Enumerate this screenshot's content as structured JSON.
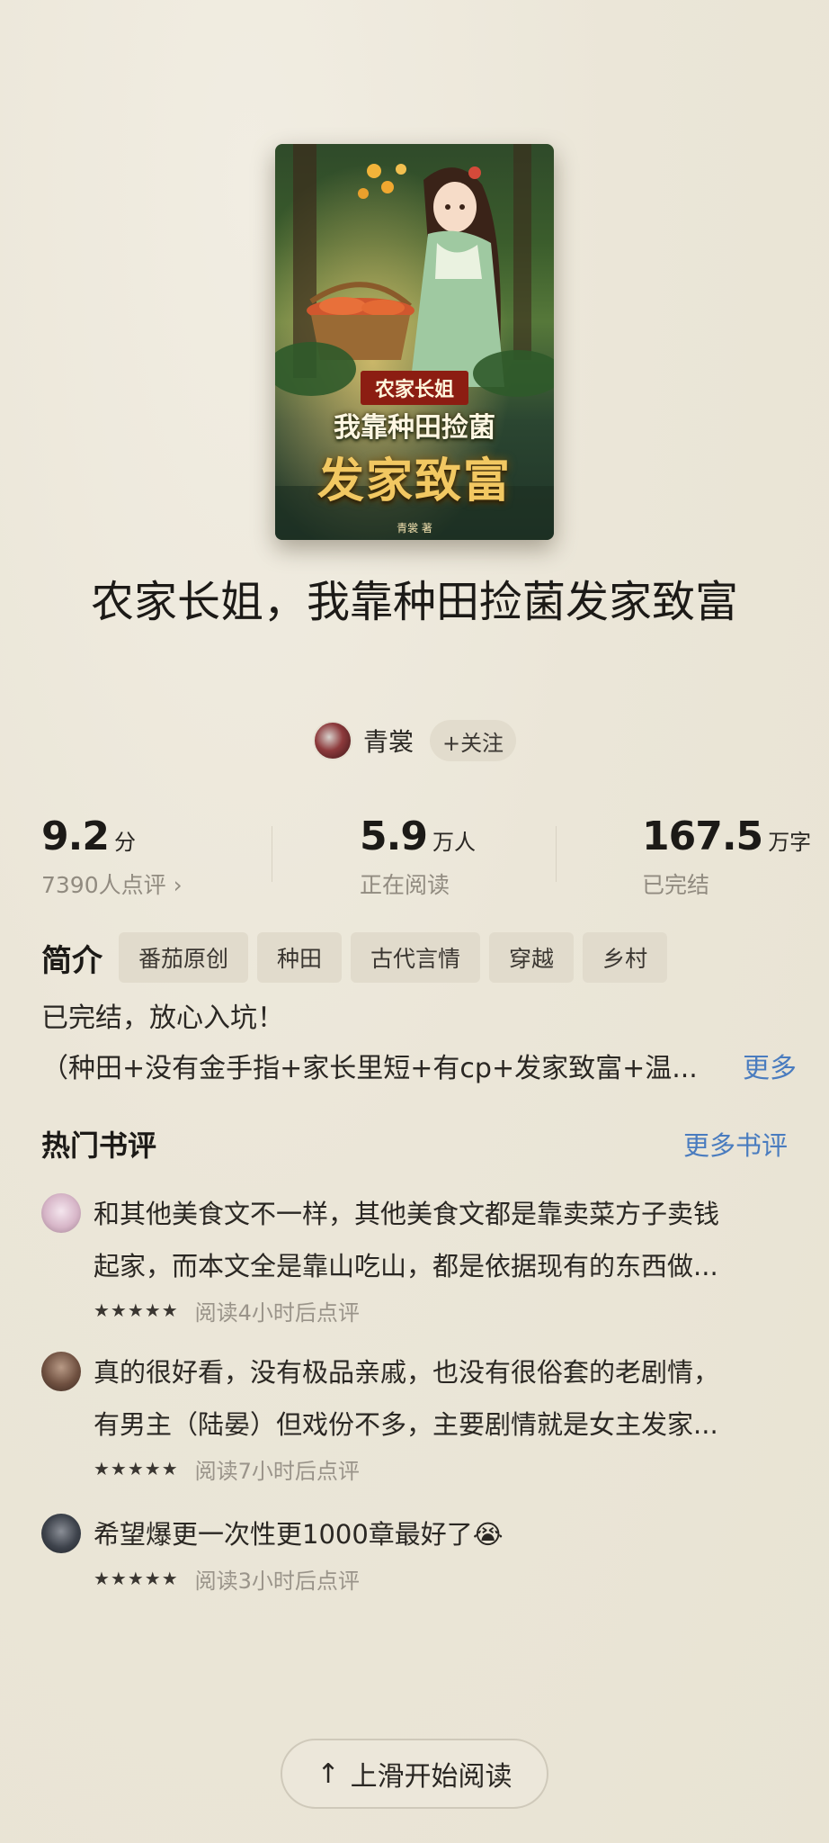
{
  "book": {
    "cover": {
      "tag_line": "农家长姐",
      "title_line": "我靠种田捡菌",
      "big_line": "发家致富",
      "author_mark": "青裳 著"
    },
    "title": "农家长姐，我靠种田捡菌发家致富",
    "author": {
      "name": "青裳",
      "follow_label": "+关注"
    }
  },
  "stats": {
    "score": {
      "value": "9.2",
      "unit": "分",
      "sub": "7390人点评 ›"
    },
    "readers": {
      "value": "5.9",
      "unit": "万人",
      "sub": "正在阅读"
    },
    "words": {
      "value": "167.5",
      "unit": "万字",
      "sub": "已完结"
    }
  },
  "intro": {
    "label": "简介",
    "tags": [
      "番茄原创",
      "种田",
      "古代言情",
      "穿越",
      "乡村"
    ],
    "line1": "已完结，放心入坑！",
    "line2": "（种田+没有金手指+家长里短+有cp+发家致富+温...",
    "more_label": "更多"
  },
  "reviews": {
    "title": "热门书评",
    "more_label": "更多书评",
    "items": [
      {
        "line1": "和其他美食文不一样，其他美食文都是靠卖菜方子卖钱",
        "line2": "起家，而本文全是靠山吃山，都是依据现有的东西做...",
        "stars": "★★★★★",
        "time": "阅读4小时后点评"
      },
      {
        "line1": "真的很好看，没有极品亲戚，也没有很俗套的老剧情，",
        "line2": "有男主（陆晏）但戏份不多，主要剧情就是女主发家...",
        "stars": "★★★★★",
        "time": "阅读7小时后点评"
      },
      {
        "line1": "希望爆更一次性更1000章最好了😭",
        "stars": "★★★★★",
        "time": "阅读3小时后点评"
      }
    ]
  },
  "start_button": {
    "icon": "arrow-up-icon",
    "label": "上滑开始阅读"
  },
  "colors": {
    "background": "#ebe6d8",
    "link": "#4a7cbf",
    "muted": "#918b80"
  }
}
